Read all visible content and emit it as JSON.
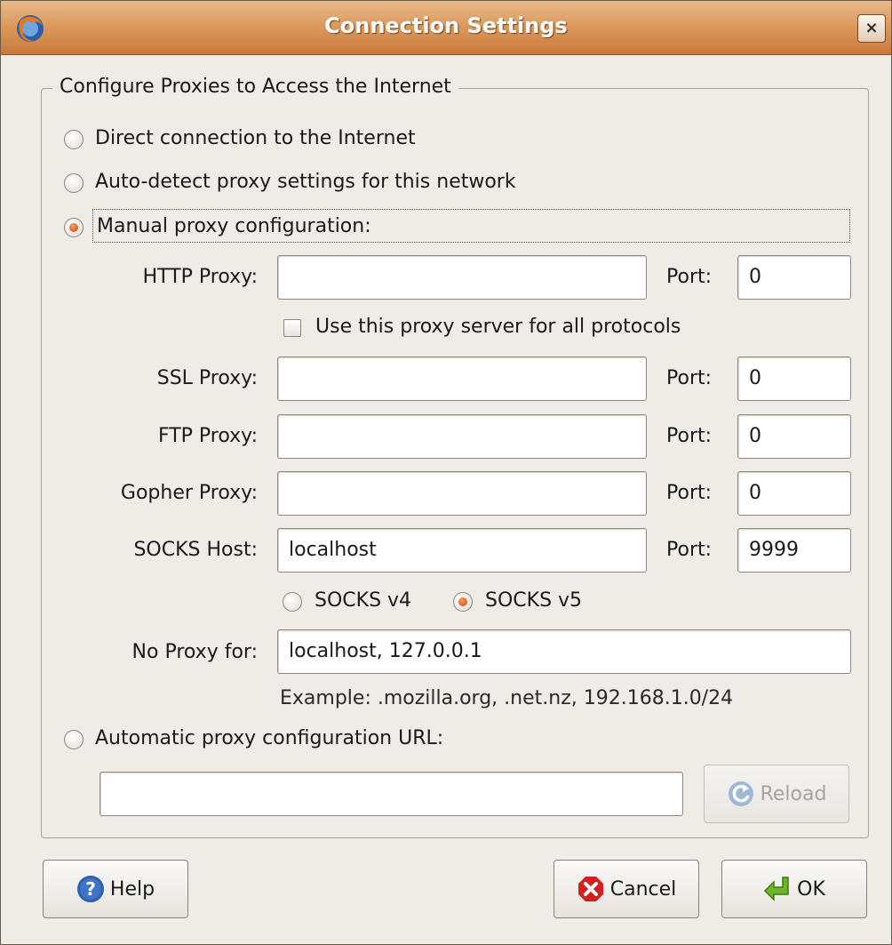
{
  "window": {
    "title": "Connection Settings",
    "close_label": "×"
  },
  "group": {
    "legend": "Configure Proxies to Access the Internet"
  },
  "options": {
    "direct": {
      "label": "Direct connection to the Internet",
      "selected": false
    },
    "auto_detect": {
      "label": "Auto-detect proxy settings for this network",
      "selected": false
    },
    "manual": {
      "label": "Manual proxy configuration:",
      "selected": true
    },
    "auto_url": {
      "label": "Automatic proxy configuration URL:",
      "selected": false
    }
  },
  "manual": {
    "http": {
      "label": "HTTP Proxy:",
      "value": "",
      "port_label": "Port:",
      "port": "0"
    },
    "use_for_all": {
      "label": "Use this proxy server for all protocols",
      "checked": false
    },
    "ssl": {
      "label": "SSL Proxy:",
      "value": "",
      "port_label": "Port:",
      "port": "0"
    },
    "ftp": {
      "label": "FTP Proxy:",
      "value": "",
      "port_label": "Port:",
      "port": "0"
    },
    "gopher": {
      "label": "Gopher Proxy:",
      "value": "",
      "port_label": "Port:",
      "port": "0"
    },
    "socks": {
      "label": "SOCKS Host:",
      "value": "localhost",
      "port_label": "Port:",
      "port": "9999"
    },
    "socks_v4": {
      "label": "SOCKS v4",
      "selected": false
    },
    "socks_v5": {
      "label": "SOCKS v5",
      "selected": true
    },
    "no_proxy": {
      "label": "No Proxy for:",
      "value": "localhost, 127.0.0.1"
    },
    "example": "Example: .mozilla.org, .net.nz, 192.168.1.0/24"
  },
  "auto_url": {
    "value": "",
    "reload_label": "Reload"
  },
  "buttons": {
    "help": "Help",
    "cancel": "Cancel",
    "ok": "OK"
  },
  "colors": {
    "titlebar": "#dc9b5e",
    "radio_selected": "#e2581a",
    "background": "#efebe7"
  }
}
